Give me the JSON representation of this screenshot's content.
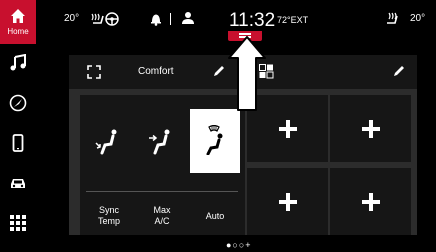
{
  "status": {
    "inside_temp": "20°",
    "clock": "11:32",
    "outside_temp": "72°EXT",
    "right_temp": "20°"
  },
  "sidebar": {
    "home_label": "Home",
    "items": [
      "music-icon",
      "navigation-icon",
      "phone-icon",
      "vehicle-icon",
      "apps-icon"
    ]
  },
  "panel": {
    "title": "Comfort",
    "controls": {
      "sync": "Sync\nTemp",
      "max_ac": "Max\nA/C",
      "auto": "Auto"
    },
    "selected_mode": 2
  },
  "pager": {
    "dots": "●○○+"
  },
  "colors": {
    "accent": "#c8102e",
    "panel": "#2c2c2c",
    "tile": "#161616"
  }
}
